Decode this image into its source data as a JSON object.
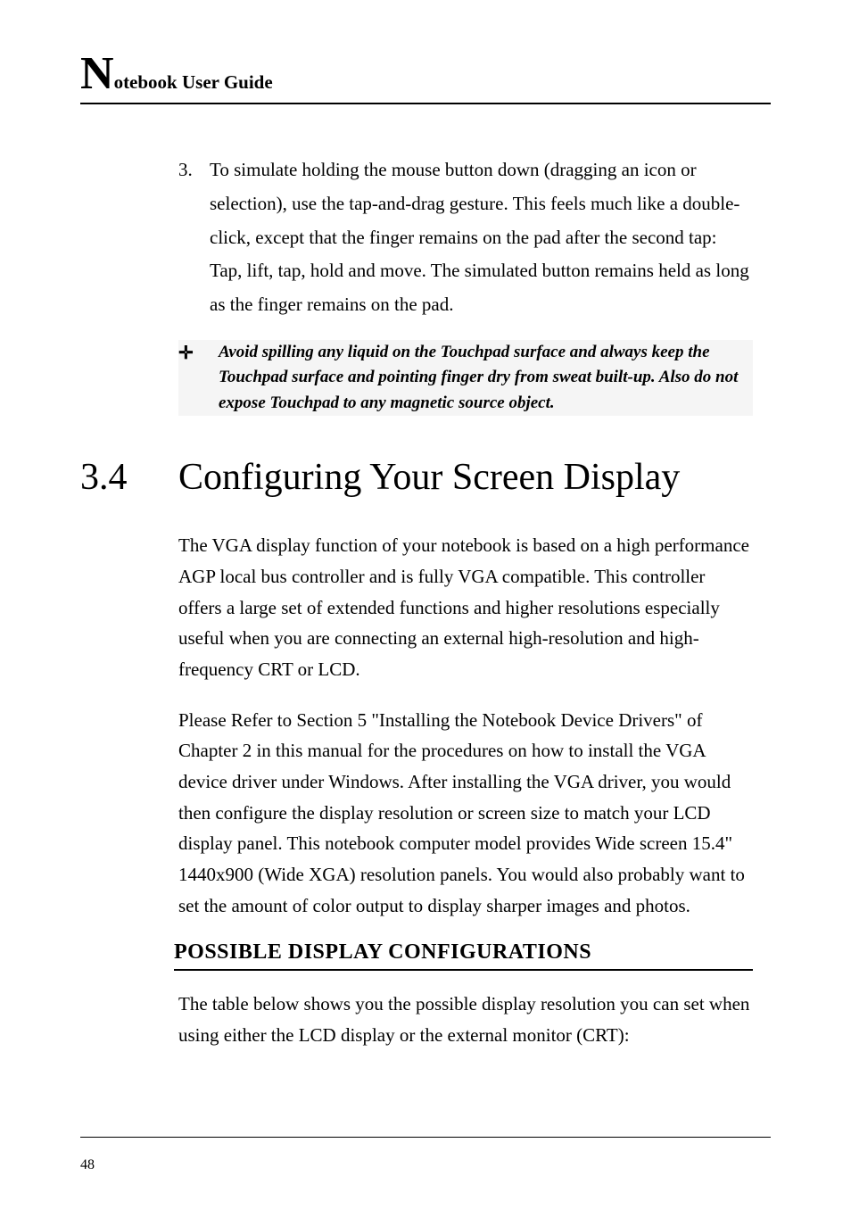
{
  "header": {
    "big_letter": "N",
    "title_rest": "otebook User Guide"
  },
  "list_item_3": {
    "number": "3.",
    "text": "To simulate holding the mouse button down (dragging an icon or selection), use the tap-and-drag gesture. This feels much like a double-click, except that the finger remains on the pad after the second tap: Tap, lift, tap, hold and move. The simulated button remains held as long as the finger remains on the pad."
  },
  "callout": {
    "icon": "✛",
    "text": "Avoid spilling any liquid on the Touchpad surface and always keep the Touchpad surface and pointing finger dry from sweat built-up. Also do not expose Touchpad to any magnetic source object."
  },
  "section": {
    "number": "3.4",
    "title": "Configuring Your Screen Display"
  },
  "para1": "The VGA display function of your notebook is based on a high performance AGP local bus controller and is fully VGA compatible. This controller offers a large set of extended functions and higher resolutions especially useful when you are connecting an external high-resolution and high-frequency CRT or LCD.",
  "para2": "Please Refer to Section 5 \"Installing the Notebook Device Drivers\" of Chapter 2 in this manual for the procedures on how to install the VGA device driver under Windows. After installing the VGA driver, you would then configure the display resolution or screen size to match your LCD display panel. This notebook computer model provides Wide screen 15.4\" 1440x900 (Wide XGA) resolution panels. You would also probably want to set the amount of color output to display sharper images and photos.",
  "subhead": "POSSIBLE DISPLAY CONFIGURATIONS",
  "para3": "The table below shows you the possible display resolution you can set when using either the LCD display or the external monitor (CRT):",
  "footer": {
    "page": "48"
  }
}
